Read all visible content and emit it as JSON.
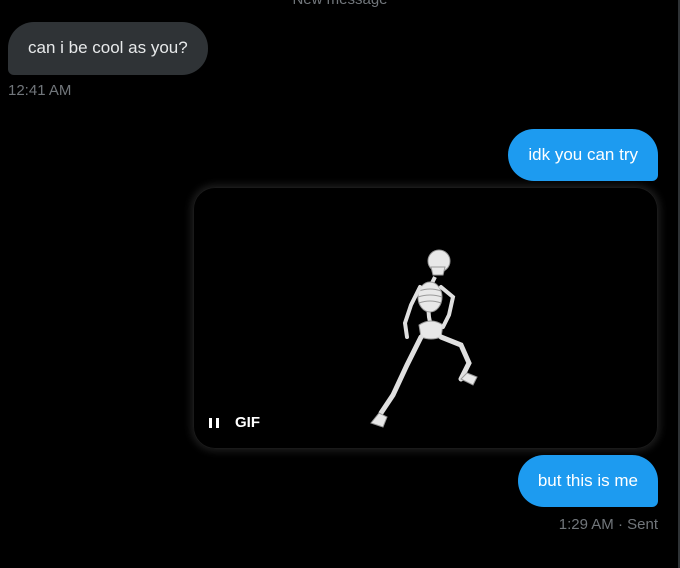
{
  "header": {
    "divider_text": "New message"
  },
  "messages": {
    "received": {
      "text": "can i be cool as you?",
      "time": "12:41 AM"
    },
    "sent_1": {
      "text": "idk you can try"
    },
    "media": {
      "label": "GIF",
      "state": "playing",
      "pause_icon": "pause-icon"
    },
    "sent_2": {
      "text": "but this is me"
    },
    "sent_status": {
      "time": "1:29 AM",
      "separator": "·",
      "status": "Sent"
    }
  },
  "colors": {
    "background": "#000000",
    "received_bubble": "#2f3336",
    "sent_bubble": "#1d9bf0",
    "muted_text": "#71767b"
  }
}
